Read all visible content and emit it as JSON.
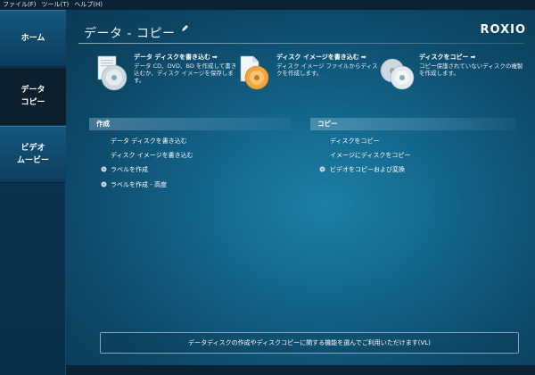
{
  "menu": {
    "file": "ファイル(F)",
    "tools": "ツール(T)",
    "help": "ヘルプ(H)"
  },
  "sidebar": {
    "items": [
      {
        "lines": [
          "ホーム"
        ]
      },
      {
        "lines": [
          "データ",
          "コピー"
        ]
      },
      {
        "lines": [
          "ビデオ",
          "ムービー"
        ]
      }
    ]
  },
  "header": {
    "title": "データ - コピー",
    "logo": "ROXIO"
  },
  "tasks": [
    {
      "title": "データ ディスクを書き込む",
      "desc": "データ CD、DVD、BD を作成して書き込むか、ディスク イメージを保存します。",
      "icon": "data-disc-icon"
    },
    {
      "title": "ディスク イメージを書き込む",
      "desc": "ディスク イメージ ファイルからディスクを作成します。",
      "icon": "disc-image-icon"
    },
    {
      "title": "ディスクをコピー",
      "desc": "コピー保護されていないディスクの複製を作成します。",
      "icon": "copy-disc-icon"
    }
  ],
  "sections": {
    "create": {
      "heading": "作成",
      "links": [
        "データ ディスクを書き込む",
        "ディスク イメージを書き込む",
        "ラベルを作成",
        "ラベルを作成 - 高度"
      ]
    },
    "copy": {
      "heading": "コピー",
      "links": [
        "ディスクをコピー",
        "イメージにディスクをコピー",
        "ビデオをコピーおよび変換"
      ]
    }
  },
  "footer": {
    "text": "データディスクの作成やディスクコピーに関する機能を選んでご利用いただけます(VL)"
  },
  "colors": {
    "accent": "#13658a",
    "sidebar": "#0b3652",
    "active_nav": "#0d1e2c"
  }
}
